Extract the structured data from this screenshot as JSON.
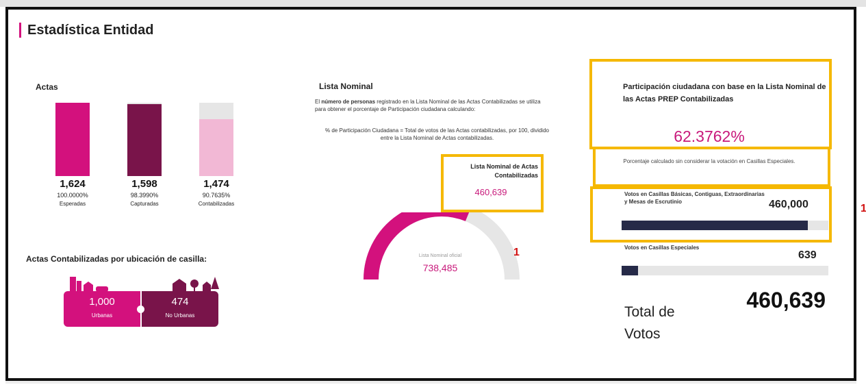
{
  "page": {
    "title": "Estadística Entidad"
  },
  "actas": {
    "title": "Actas",
    "items": [
      {
        "count": "1,624",
        "percent": "100.0000%",
        "label": "Esperadas",
        "fill": 1.0,
        "color": "#d3117d"
      },
      {
        "count": "1,598",
        "percent": "98.3990%",
        "label": "Capturadas",
        "fill": 0.984,
        "color": "#79144a"
      },
      {
        "count": "1,474",
        "percent": "90.7635%",
        "label": "Contabilizadas",
        "fill": 0.776,
        "color": "#f2b8d5"
      }
    ]
  },
  "ubicacion": {
    "title": "Actas Contabilizadas por ubicación de casilla:",
    "urbanas": {
      "count": "1,000",
      "label": "Urbanas",
      "color": "#d3117d"
    },
    "no_urbanas": {
      "count": "474",
      "label": "No Urbanas",
      "color": "#79144a"
    }
  },
  "lista_nominal": {
    "title": "Lista  Nominal",
    "desc_bold": "número de personas",
    "desc_pre": "El",
    "desc_post": "registrado en la Lista Nominal de las Actas Contabilizadas se utiliza para obtener el porcentaje de Participación ciudadana calculando:",
    "formula": "% de Participación Ciudadana = Total de votos de las Actas contabilizadas, por 100, dividido entre la Lista Nominal de Actas contabilizadas.",
    "official_label": "Lista Nominal oficial",
    "official_value": "738,485",
    "gauge_fraction": 0.6238,
    "callout_title": "Lista Nominal de Actas Contabilizadas",
    "callout_value": "460,639",
    "marker": "1"
  },
  "participacion": {
    "title": "Participación ciudadana con base en la Lista Nominal de las Actas PREP Contabilizadas",
    "percent": "62.3762%",
    "note": "Porcentaje calculado sin considerar la votación en Casillas Especiales.",
    "basicas_label": "Votos en Casillas Básicas, Contiguas, Extraordinarias y Mesas de Escrutinio",
    "basicas_value": "460,000",
    "basicas_fraction": 0.9,
    "especiales_label": "Votos en Casillas Especiales",
    "especiales_value": "639",
    "especiales_fraction": 0.08,
    "total_label": "Total de Votos",
    "total_value": "460,639",
    "marker": "1"
  },
  "colors": {
    "accent": "#d3117d",
    "dark": "#79144a",
    "highlight": "#f5b800",
    "navy": "#262a48"
  }
}
